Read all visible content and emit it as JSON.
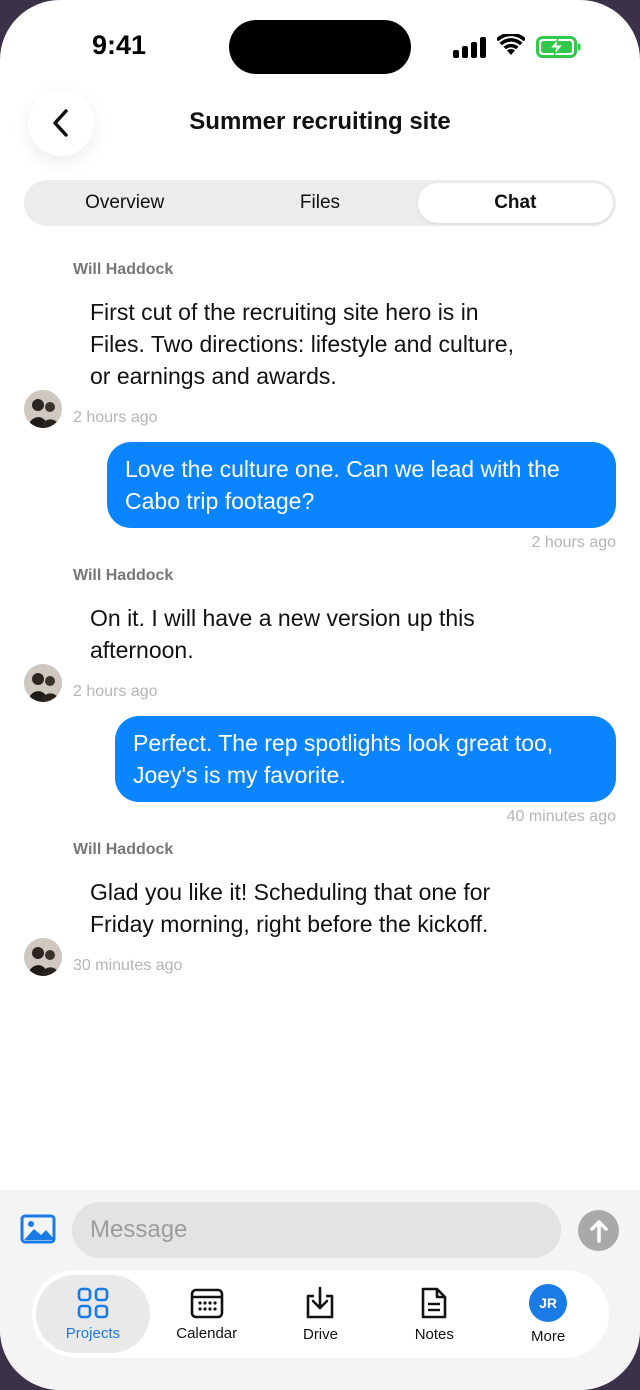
{
  "status_bar": {
    "time": "9:41"
  },
  "header": {
    "title": "Summer recruiting site"
  },
  "tabs": [
    {
      "label": "Overview",
      "active": false
    },
    {
      "label": "Files",
      "active": false
    },
    {
      "label": "Chat",
      "active": true
    }
  ],
  "messages": [
    {
      "direction": "incoming",
      "sender": "Will Haddock",
      "text": "First cut of the recruiting site hero is in Files. Two directions: lifestyle and culture, or earnings and awards.",
      "time": "2 hours ago"
    },
    {
      "direction": "outgoing",
      "text": "Love the culture one. Can we lead with the Cabo trip footage?",
      "time": "2 hours ago"
    },
    {
      "direction": "incoming",
      "sender": "Will Haddock",
      "text": "On it. I will have a new version up this afternoon.",
      "time": "2 hours ago"
    },
    {
      "direction": "outgoing",
      "text": "Perfect. The rep spotlights look great too, Joey's is my favorite.",
      "time": "40 minutes ago"
    },
    {
      "direction": "incoming",
      "sender": "Will Haddock",
      "text": "Glad you like it! Scheduling that one for Friday morning, right before the kickoff.",
      "time": "30 minutes ago"
    }
  ],
  "composer": {
    "placeholder": "Message",
    "value": ""
  },
  "nav": {
    "items": [
      {
        "label": "Projects",
        "icon": "grid-icon",
        "active": true
      },
      {
        "label": "Calendar",
        "icon": "calendar-icon",
        "active": false
      },
      {
        "label": "Drive",
        "icon": "download-icon",
        "active": false
      },
      {
        "label": "Notes",
        "icon": "document-icon",
        "active": false
      },
      {
        "label": "More",
        "icon": "avatar",
        "active": false
      }
    ],
    "avatar_initials": "JR"
  },
  "colors": {
    "accent": "#0b84ff",
    "nav_active": "#1a7be6"
  }
}
